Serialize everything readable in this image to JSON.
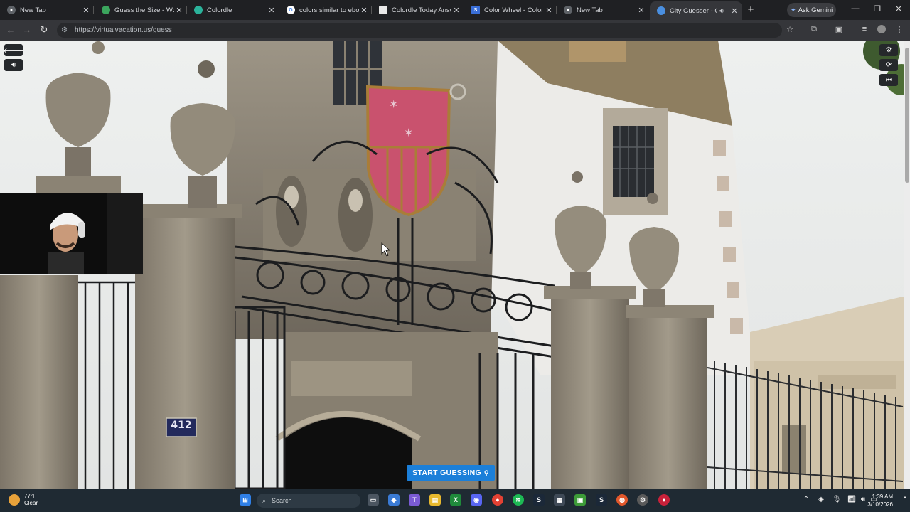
{
  "browser": {
    "tabs": [
      {
        "title": "New Tab",
        "icon": "chrome-icon",
        "active": false
      },
      {
        "title": "Guess the Size - World",
        "icon": "globe-icon",
        "active": false
      },
      {
        "title": "Colordle",
        "icon": "colordle-icon",
        "active": false
      },
      {
        "title": "colors similar to ebony",
        "icon": "google-icon",
        "active": false
      },
      {
        "title": "Colordle Today Answer",
        "icon": "page-icon",
        "active": false
      },
      {
        "title": "Color Wheel - Color Ca",
        "icon": "s-icon",
        "active": false
      },
      {
        "title": "New Tab",
        "icon": "chrome-icon",
        "active": false
      },
      {
        "title": "City Guesser - Can",
        "icon": "globe-icon",
        "active": true
      }
    ],
    "new_tab_symbol": "+",
    "gemini_label": "Ask Gemini",
    "url": "https://virtualvacation.us/guess"
  },
  "game": {
    "start_button_label": "START GUESSING",
    "house_number": "412"
  },
  "taskbar": {
    "weather_temp": "77°F",
    "weather_desc": "Clear",
    "search_placeholder": "Search",
    "time": "1:39 AM",
    "date": "3/10/2026"
  },
  "colors": {
    "start_button": "#1b7fd9",
    "taskbar": "#1f2a33",
    "browser_tabbar": "#1f2023"
  }
}
